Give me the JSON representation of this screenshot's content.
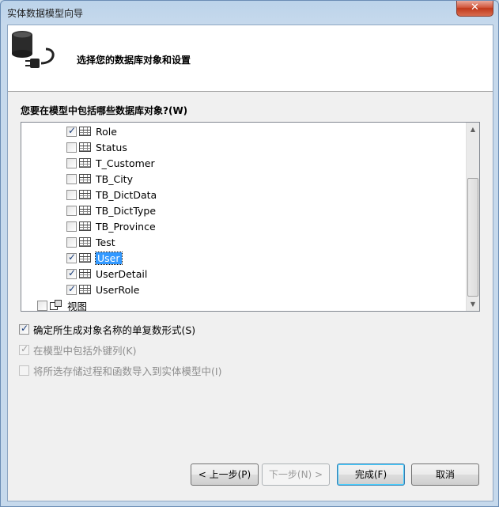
{
  "window": {
    "title": "实体数据模型向导",
    "close_label": "✕"
  },
  "header": {
    "title": "选择您的数据库对象和设置",
    "icon": "database-plug-icon"
  },
  "prompt": "您要在模型中包括哪些数据库对象?(W)",
  "tree": {
    "items": [
      {
        "label": "Role",
        "checked": true
      },
      {
        "label": "Status",
        "checked": false
      },
      {
        "label": "T_Customer",
        "checked": false
      },
      {
        "label": "TB_City",
        "checked": false
      },
      {
        "label": "TB_DictData",
        "checked": false
      },
      {
        "label": "TB_DictType",
        "checked": false
      },
      {
        "label": "TB_Province",
        "checked": false
      },
      {
        "label": "Test",
        "checked": false
      },
      {
        "label": "User",
        "checked": true,
        "selected": true
      },
      {
        "label": "UserDetail",
        "checked": true
      },
      {
        "label": "UserRole",
        "checked": true
      }
    ],
    "views_label": "视图"
  },
  "options": {
    "pluralize": "确定所生成对象名称的单复数形式(S)",
    "foreign_keys": "在模型中包括外键列(K)",
    "import_procs": "将所选存储过程和函数导入到实体模型中(I)"
  },
  "buttons": {
    "prev": "< 上一步(P)",
    "next": "下一步(N) >",
    "finish": "完成(F)",
    "cancel": "取消"
  }
}
